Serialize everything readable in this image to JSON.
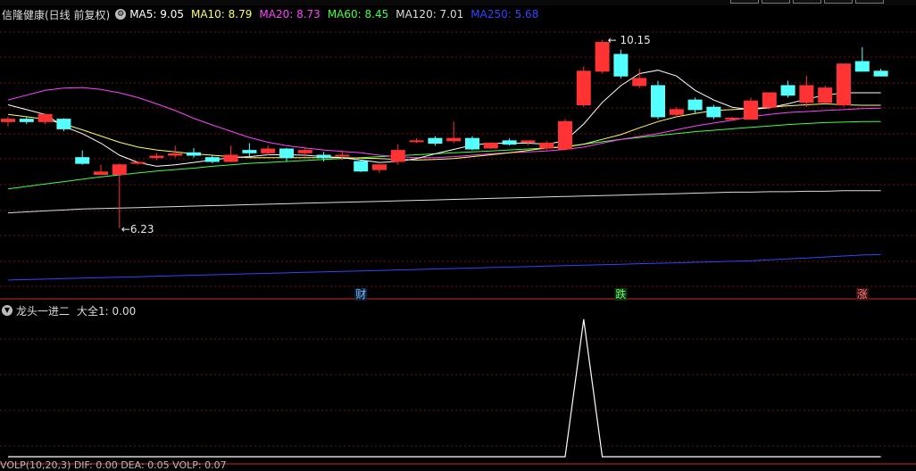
{
  "header": {
    "stock_name": "信隆健康(日线 前复权)",
    "ma": [
      {
        "label": "MA5: 9.05",
        "color": "#ffffff",
        "period": 5
      },
      {
        "label": "MA10: 8.79",
        "color": "#ffff66",
        "period": 10
      },
      {
        "label": "MA20: 8.73",
        "color": "#ff44ff",
        "period": 20
      },
      {
        "label": "MA60: 8.45",
        "color": "#44ff44",
        "period": 60
      },
      {
        "label": "MA120: 7.01",
        "color": "#dddddd",
        "period": 120
      },
      {
        "label": "MA250: 5.68",
        "color": "#3344ff",
        "period": 250
      }
    ]
  },
  "price_chart": {
    "high_label": "10.15",
    "low_label": "6.23",
    "high_value": 10.15,
    "low_value": 6.23,
    "grid": true,
    "up_color": "#ff3333",
    "down_color": "#54ffff",
    "candles": [
      [
        8.45,
        8.55,
        8.35,
        8.5
      ],
      [
        8.5,
        8.55,
        8.4,
        8.45
      ],
      [
        8.45,
        8.62,
        8.4,
        8.6
      ],
      [
        8.5,
        8.52,
        8.25,
        8.3
      ],
      [
        7.7,
        7.85,
        7.55,
        7.58
      ],
      [
        7.35,
        7.55,
        7.35,
        7.4
      ],
      [
        7.35,
        7.58,
        6.23,
        7.55
      ],
      [
        7.6,
        7.62,
        7.55,
        7.6
      ],
      [
        7.7,
        7.8,
        7.65,
        7.73
      ],
      [
        7.75,
        7.95,
        7.7,
        7.78
      ],
      [
        7.8,
        7.9,
        7.7,
        7.75
      ],
      [
        7.7,
        7.75,
        7.58,
        7.62
      ],
      [
        7.62,
        7.95,
        7.6,
        7.75
      ],
      [
        7.85,
        8.0,
        7.7,
        7.8
      ],
      [
        7.8,
        7.95,
        7.75,
        7.88
      ],
      [
        7.88,
        7.9,
        7.62,
        7.7
      ],
      [
        7.8,
        7.9,
        7.72,
        7.85
      ],
      [
        7.75,
        7.82,
        7.62,
        7.7
      ],
      [
        7.75,
        7.85,
        7.65,
        7.75
      ],
      [
        7.62,
        7.65,
        7.4,
        7.42
      ],
      [
        7.45,
        7.55,
        7.38,
        7.55
      ],
      [
        7.62,
        7.98,
        7.55,
        7.85
      ],
      [
        8.05,
        8.1,
        8.0,
        8.05
      ],
      [
        8.1,
        8.15,
        7.95,
        8.0
      ],
      [
        8.05,
        8.45,
        8.0,
        8.1
      ],
      [
        8.1,
        8.15,
        7.85,
        7.88
      ],
      [
        7.9,
        8.02,
        7.88,
        8.0
      ],
      [
        8.05,
        8.1,
        7.95,
        7.98
      ],
      [
        8.02,
        8.05,
        7.95,
        8.05
      ],
      [
        7.9,
        8.05,
        7.85,
        8.0
      ],
      [
        7.88,
        8.5,
        7.85,
        8.45
      ],
      [
        8.8,
        9.6,
        8.75,
        9.5
      ],
      [
        9.5,
        10.15,
        9.45,
        10.1
      ],
      [
        9.85,
        9.95,
        9.35,
        9.4
      ],
      [
        9.2,
        9.55,
        9.15,
        9.35
      ],
      [
        9.2,
        9.3,
        8.5,
        8.55
      ],
      [
        8.6,
        8.75,
        8.55,
        8.7
      ],
      [
        8.9,
        8.95,
        8.62,
        8.7
      ],
      [
        8.75,
        8.8,
        8.5,
        8.55
      ],
      [
        8.5,
        8.55,
        8.48,
        8.52
      ],
      [
        8.5,
        8.95,
        8.5,
        8.88
      ],
      [
        8.75,
        9.05,
        8.7,
        9.05
      ],
      [
        9.2,
        9.3,
        8.95,
        9.0
      ],
      [
        8.85,
        9.4,
        8.75,
        9.2
      ],
      [
        8.85,
        9.2,
        8.8,
        9.15
      ],
      [
        8.8,
        9.6,
        8.75,
        9.65
      ],
      [
        9.7,
        10.0,
        9.5,
        9.5
      ],
      [
        9.5,
        9.55,
        9.4,
        9.4
      ]
    ],
    "ma5": [
      8.8,
      8.7,
      8.6,
      8.35,
      8.2,
      8.0,
      7.75,
      7.6,
      7.52,
      7.55,
      7.6,
      7.65,
      7.7,
      7.72,
      7.76,
      7.76,
      7.75,
      7.72,
      7.7,
      7.65,
      7.6,
      7.62,
      7.68,
      7.78,
      7.87,
      7.96,
      8.0,
      8.0,
      8.0,
      7.98,
      8.05,
      8.4,
      8.85,
      9.2,
      9.45,
      9.52,
      9.4,
      9.1,
      8.9,
      8.75,
      8.7,
      8.74,
      8.82,
      8.92,
      9.0,
      9.05,
      9.05,
      9.05
    ],
    "ma10": [
      8.6,
      8.55,
      8.5,
      8.4,
      8.28,
      8.15,
      8.02,
      7.92,
      7.86,
      7.82,
      7.78,
      7.75,
      7.72,
      7.7,
      7.7,
      7.7,
      7.7,
      7.7,
      7.7,
      7.69,
      7.68,
      7.66,
      7.65,
      7.66,
      7.68,
      7.72,
      7.76,
      7.8,
      7.85,
      7.9,
      7.92,
      7.98,
      8.08,
      8.18,
      8.32,
      8.45,
      8.55,
      8.62,
      8.68,
      8.7,
      8.72,
      8.75,
      8.78,
      8.8,
      8.82,
      8.8,
      8.79,
      8.79
    ],
    "ma20": [
      8.9,
      9.0,
      9.1,
      9.15,
      9.16,
      9.12,
      9.05,
      8.95,
      8.82,
      8.68,
      8.52,
      8.38,
      8.25,
      8.12,
      8.02,
      7.95,
      7.9,
      7.86,
      7.83,
      7.8,
      7.75,
      7.72,
      7.7,
      7.7,
      7.72,
      7.75,
      7.78,
      7.8,
      7.82,
      7.84,
      7.87,
      7.92,
      8.0,
      8.08,
      8.14,
      8.2,
      8.28,
      8.36,
      8.42,
      8.48,
      8.55,
      8.6,
      8.64,
      8.66,
      8.68,
      8.7,
      8.72,
      8.73
    ],
    "ma60": [
      7.05,
      7.1,
      7.15,
      7.2,
      7.25,
      7.3,
      7.34,
      7.38,
      7.42,
      7.45,
      7.48,
      7.52,
      7.55,
      7.58,
      7.6,
      7.62,
      7.64,
      7.66,
      7.68,
      7.7,
      7.72,
      7.74,
      7.76,
      7.78,
      7.8,
      7.82,
      7.84,
      7.86,
      7.88,
      7.9,
      7.93,
      7.98,
      8.03,
      8.08,
      8.12,
      8.16,
      8.2,
      8.24,
      8.27,
      8.3,
      8.33,
      8.36,
      8.39,
      8.41,
      8.43,
      8.44,
      8.45,
      8.45
    ],
    "ma120": [
      6.55,
      6.57,
      6.59,
      6.61,
      6.63,
      6.64,
      6.65,
      6.66,
      6.67,
      6.68,
      6.69,
      6.7,
      6.71,
      6.72,
      6.73,
      6.74,
      6.75,
      6.76,
      6.77,
      6.78,
      6.79,
      6.8,
      6.81,
      6.82,
      6.83,
      6.84,
      6.85,
      6.86,
      6.87,
      6.88,
      6.89,
      6.9,
      6.91,
      6.92,
      6.93,
      6.94,
      6.95,
      6.96,
      6.97,
      6.98,
      6.98,
      6.99,
      6.99,
      7.0,
      7.0,
      7.01,
      7.01,
      7.01
    ],
    "ma250": [
      5.15,
      5.16,
      5.17,
      5.18,
      5.19,
      5.2,
      5.21,
      5.22,
      5.23,
      5.24,
      5.25,
      5.26,
      5.27,
      5.28,
      5.29,
      5.3,
      5.31,
      5.32,
      5.33,
      5.34,
      5.35,
      5.36,
      5.37,
      5.38,
      5.39,
      5.4,
      5.41,
      5.42,
      5.43,
      5.44,
      5.45,
      5.46,
      5.47,
      5.48,
      5.49,
      5.5,
      5.51,
      5.52,
      5.53,
      5.54,
      5.55,
      5.57,
      5.59,
      5.61,
      5.63,
      5.65,
      5.67,
      5.68
    ],
    "event_marks": [
      {
        "label": "财",
        "index": 19,
        "color": "#79b9ff",
        "bg": "#10223a"
      },
      {
        "label": "跌",
        "index": 33,
        "color": "#66ff66",
        "bg": "#123012"
      },
      {
        "label": "涨",
        "index": 46,
        "color": "#ff8080",
        "bg": "#3a1010"
      }
    ]
  },
  "indicator": {
    "title": "龙头一进二",
    "value_label": "大全1: 0.00",
    "values": [
      0,
      0,
      0,
      0,
      0,
      0,
      0,
      0,
      0,
      0,
      0,
      0,
      0,
      0,
      0,
      0,
      0,
      0,
      0,
      0,
      0,
      0,
      0,
      0,
      0,
      0,
      0,
      0,
      0,
      0,
      0,
      1,
      0,
      0,
      0,
      0,
      0,
      0,
      0,
      0,
      0,
      0,
      0,
      0,
      0,
      0,
      0,
      0
    ]
  },
  "bottom_clipped_text": "VOLP(10,20,3) DIF: 0.00 DEA: 0.05 VOLP: 0.07"
}
